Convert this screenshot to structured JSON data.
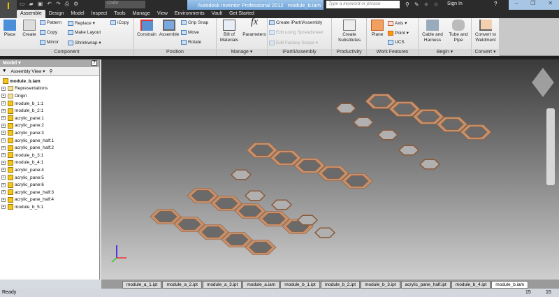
{
  "app": {
    "title": "Autodesk Inventor Professional 2012",
    "document": "module_b.iam",
    "color_select": "Color",
    "search_placeholder": "Type a keyword or phrase",
    "sign_in": "Sign In"
  },
  "tabs": [
    "Assemble",
    "Design",
    "Model",
    "Inspect",
    "Tools",
    "Manage",
    "View",
    "Environments",
    "Vault",
    "Get Started"
  ],
  "ribbon": {
    "component": {
      "label": "Component",
      "place": "Place",
      "create": "Create",
      "pattern": "Pattern",
      "copy": "Copy",
      "mirror": "Mirror",
      "replace": "Replace",
      "make_layout": "Make Layout",
      "shrinkwrap": "Shrinkwrap",
      "icopy": "iCopy"
    },
    "position": {
      "label": "Position",
      "constrain": "Constrain",
      "assemble": "Assemble",
      "grip_snap": "Grip Snap",
      "move": "Move",
      "rotate": "Rotate"
    },
    "manage": {
      "label": "Manage",
      "bom": "Bill of Materials",
      "parameters": "Parameters"
    },
    "ipart": {
      "label": "iPart/iAssembly",
      "create": "Create iPart/iAssembly",
      "edit_spreadsheet": "Edit using Spreadsheet",
      "edit_factory": "Edit Factory Scope"
    },
    "productivity": {
      "label": "Productivity",
      "create_substitutes": "Create Substitutes"
    },
    "work_features": {
      "label": "Work Features",
      "plane": "Plane",
      "axis": "Axis",
      "point": "Point",
      "ucs": "UCS"
    },
    "begin": {
      "label": "Begin",
      "cable": "Cable and Harness",
      "tube": "Tube and Pipe"
    },
    "convert": {
      "label": "Convert",
      "weldment": "Convert to Weldment"
    }
  },
  "browser": {
    "title": "Model",
    "view": "Assembly View",
    "root": "module_b.iam",
    "items": [
      "Representations",
      "Origin",
      "module_b_1:1",
      "module_b_2:1",
      "acrylic_pane:1",
      "acrylic_pane:2",
      "acrylic_pane:3",
      "acrylic_pane_half:1",
      "acrylic_pane_half:2",
      "module_b_3:1",
      "module_b_4:1",
      "acrylic_pane:4",
      "acrylic_pane:5",
      "acrylic_pane:6",
      "acrylic_pane_half:3",
      "acrylic_pane_half:4",
      "module_b_5:1"
    ]
  },
  "doc_tabs": [
    "module_a_1.ipt",
    "module_a_2.ipt",
    "module_a_3.ipt",
    "module_a.iam",
    "module_b_1.ipt",
    "module_b_2.ipt",
    "module_b_3.ipt",
    "acrylic_pane_half.ipt",
    "module_b_4.ipt",
    "module_b.iam"
  ],
  "status": {
    "text": "Ready",
    "n1": "15",
    "n2": "15"
  },
  "colors": {
    "frame": "#c8906a",
    "pane": "#b0b0b0"
  }
}
